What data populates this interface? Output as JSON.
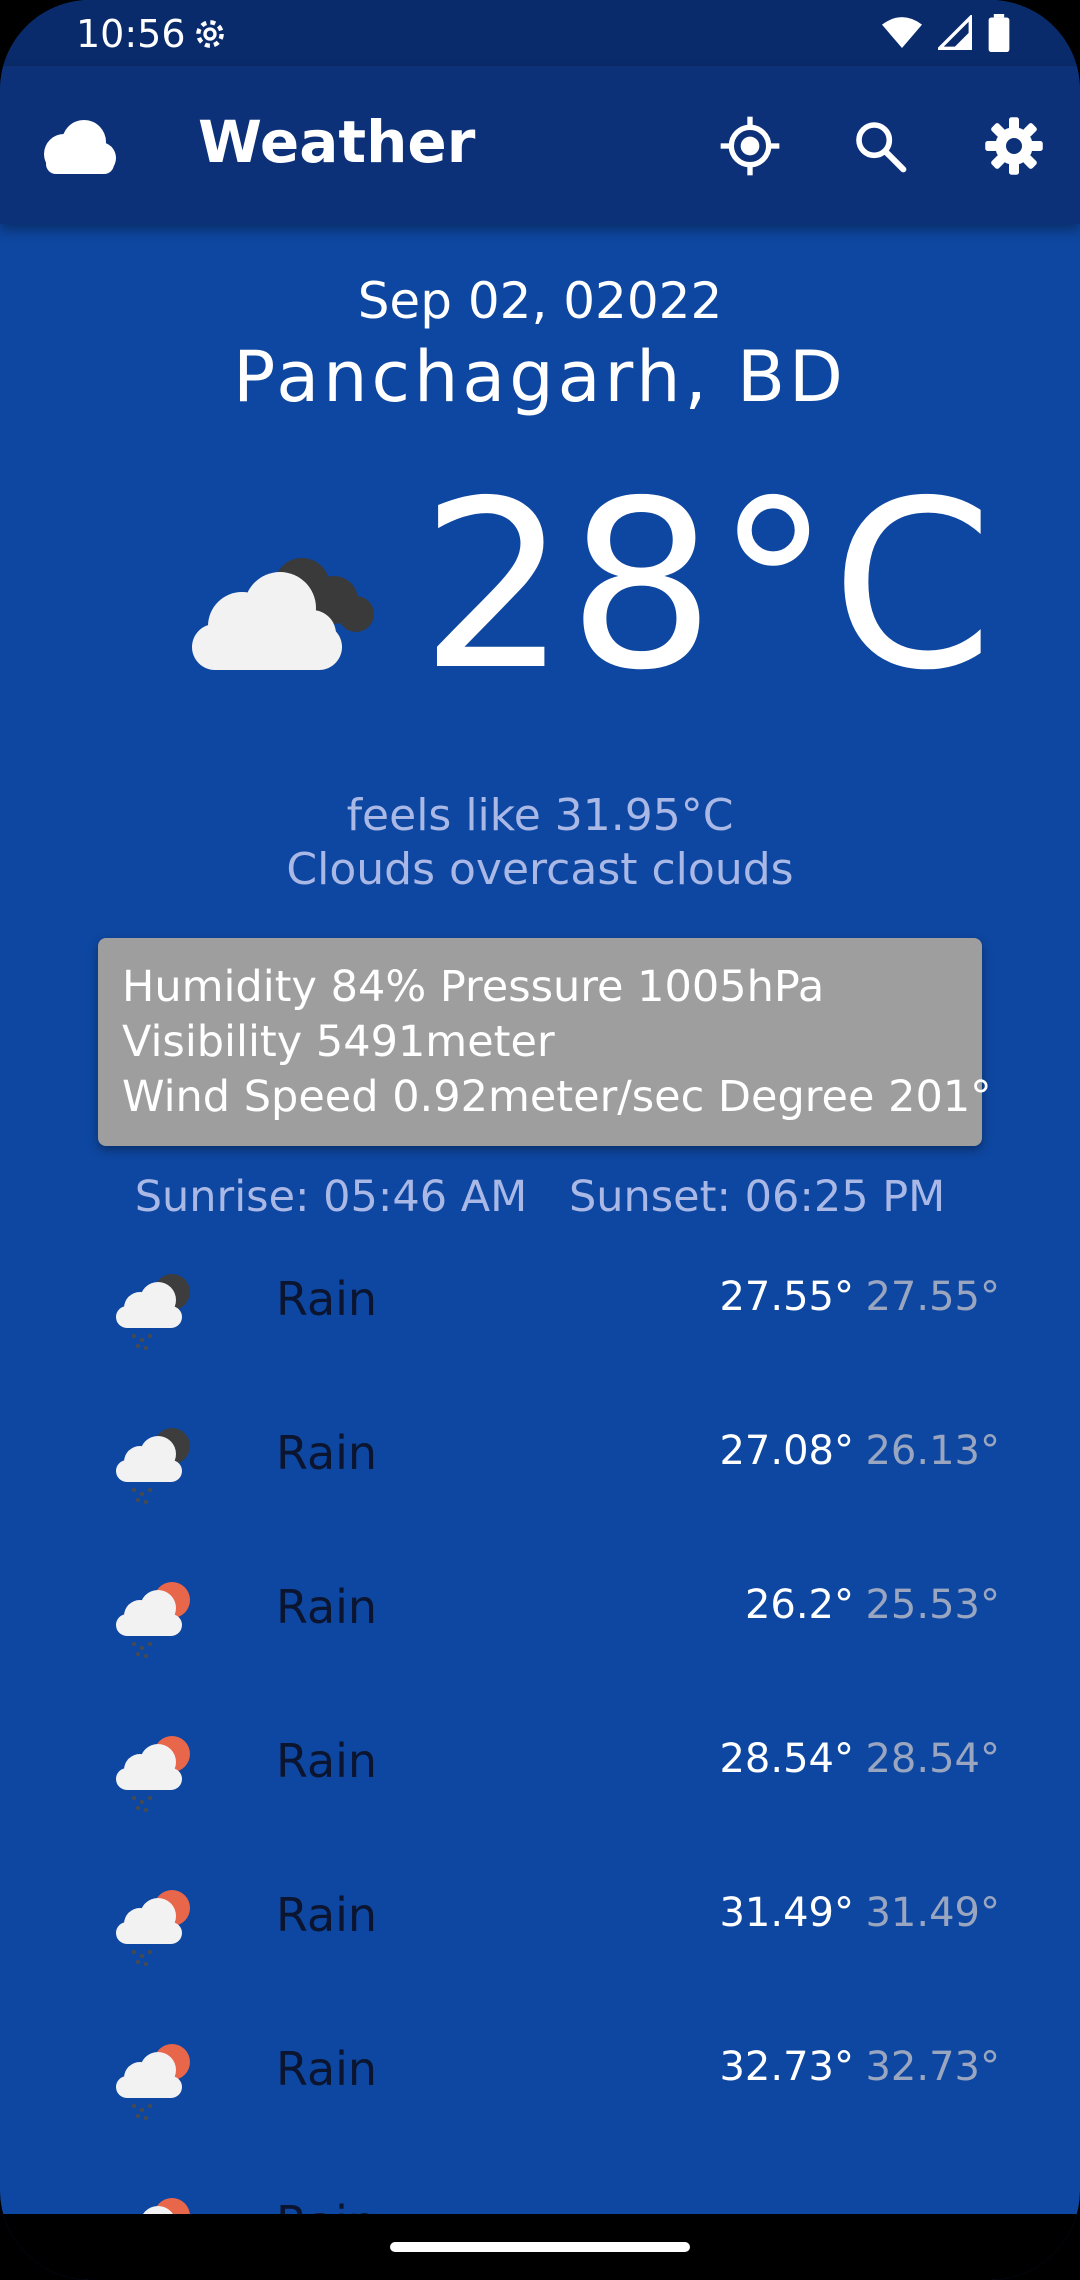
{
  "status": {
    "time": "10:56"
  },
  "app": {
    "title": "Weather"
  },
  "header": {
    "date": "Sep 02, 02022",
    "location": "Panchagarh, BD"
  },
  "current": {
    "temp": "28°C",
    "feels_like": "feels like 31.95°C",
    "description": "Clouds overcast clouds",
    "icon": "cloud-overcast-icon"
  },
  "details": {
    "line1": "Humidity 84% Pressure 1005hPa",
    "line2": "Visibility 5491meter",
    "line3": "Wind Speed 0.92meter/sec Degree 201°"
  },
  "sun": {
    "sunrise": "Sunrise: 05:46 AM",
    "sunset": "Sunset: 06:25 PM"
  },
  "forecast": [
    {
      "label": "Rain",
      "hi": "27.55°",
      "lo": "27.55°",
      "icon": "rain-night-icon"
    },
    {
      "label": "Rain",
      "hi": "27.08°",
      "lo": "26.13°",
      "icon": "rain-night-icon"
    },
    {
      "label": "Rain",
      "hi": "26.2°",
      "lo": "25.53°",
      "icon": "rain-day-icon"
    },
    {
      "label": "Rain",
      "hi": "28.54°",
      "lo": "28.54°",
      "icon": "rain-day-icon"
    },
    {
      "label": "Rain",
      "hi": "31.49°",
      "lo": "31.49°",
      "icon": "rain-day-icon"
    },
    {
      "label": "Rain",
      "hi": "32.73°",
      "lo": "32.73°",
      "icon": "rain-day-icon"
    },
    {
      "label": "Rain",
      "hi": "",
      "lo": "",
      "icon": "rain-day-icon"
    }
  ],
  "colors": {
    "background": "#0e47a1",
    "appbar": "#0d3179",
    "statusbar": "#0a2b6b",
    "details_box": "#9e9e9e",
    "muted_text": "#aab8e6"
  }
}
